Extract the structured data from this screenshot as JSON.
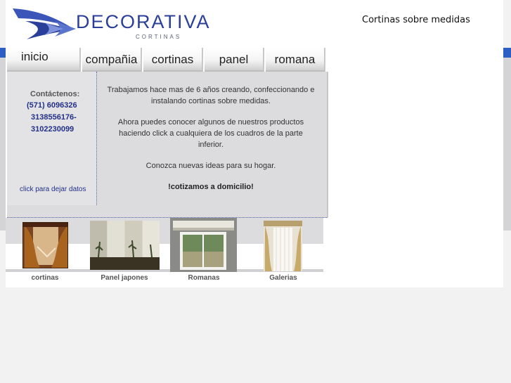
{
  "brand": {
    "name": "DECORATIVA",
    "sub": "CORTINAS"
  },
  "tagline": "Cortinas sobre medidas",
  "nav": [
    {
      "label": "inicio"
    },
    {
      "label": "compañia"
    },
    {
      "label": "cortinas"
    },
    {
      "label": "panel"
    },
    {
      "label": "romana"
    }
  ],
  "contact": {
    "title": "Contáctenos:",
    "phones": [
      "(571) 6096326",
      "3138556176-",
      "3102230099"
    ],
    "link": "click para dejar datos"
  },
  "intro": {
    "p1": "Trabajamos hace mas de 6 años creando, confeccionando e instalando cortinas sobre medidas.",
    "p2": "Ahora puedes conocer algunos de nuestros productos haciendo click a cualquiera de los cuadros de la parte inferior.",
    "p3": "Conozca nuevas ideas para su hogar.",
    "cta": "!cotizamos a domicilio!"
  },
  "gallery": [
    {
      "label": "cortinas"
    },
    {
      "label": "Panel japones"
    },
    {
      "label": "Romanas"
    },
    {
      "label": "Galerias"
    }
  ],
  "colors": {
    "brand_blue": "#2a3f9a",
    "band_blue": "#2d5ec4",
    "panel_gray": "#dcdcde"
  }
}
